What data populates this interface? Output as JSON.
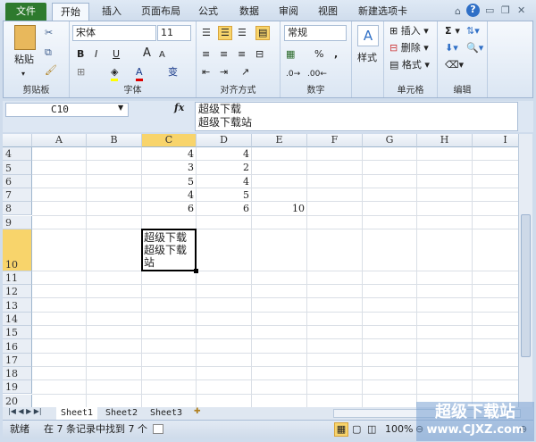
{
  "tabs": [
    "文件",
    "开始",
    "插入",
    "页面布局",
    "公式",
    "数据",
    "审阅",
    "视图",
    "新建选项卡"
  ],
  "ribbon": {
    "clipboard": {
      "label": "剪贴板",
      "paste": "粘贴"
    },
    "font": {
      "label": "字体",
      "font_name": "宋体",
      "font_size": "11"
    },
    "alignment": {
      "label": "对齐方式"
    },
    "number": {
      "label": "数字",
      "format": "常规",
      "percent": "%",
      "comma": ","
    },
    "styles": {
      "label": "样式"
    },
    "cells": {
      "label": "单元格",
      "insert": "插入",
      "delete": "删除",
      "format": "格式"
    },
    "editing": {
      "label": "编辑"
    }
  },
  "formula_bar": {
    "name_box": "C10",
    "fx": "fx",
    "content_line1": "超级下载",
    "content_line2": "超级下载站"
  },
  "columns": [
    "A",
    "B",
    "C",
    "D",
    "E",
    "F",
    "G",
    "H",
    "I"
  ],
  "rows": [
    "4",
    "5",
    "6",
    "7",
    "8",
    "9",
    "10",
    "11",
    "12",
    "13",
    "14",
    "15",
    "16",
    "17",
    "18",
    "19",
    "20"
  ],
  "cells": [
    {
      "ref": "C4",
      "value": "4"
    },
    {
      "ref": "D4",
      "value": "4"
    },
    {
      "ref": "C5",
      "value": "3"
    },
    {
      "ref": "D5",
      "value": "2"
    },
    {
      "ref": "C6",
      "value": "5"
    },
    {
      "ref": "D6",
      "value": "4"
    },
    {
      "ref": "C7",
      "value": "4"
    },
    {
      "ref": "D7",
      "value": "5"
    },
    {
      "ref": "C8",
      "value": "6"
    },
    {
      "ref": "D8",
      "value": "6"
    },
    {
      "ref": "E8",
      "value": "10"
    }
  ],
  "active_cell": {
    "ref": "C10",
    "lines": [
      "超级下载",
      "超级下载站"
    ]
  },
  "sheets": [
    "Sheet1",
    "Sheet2",
    "Sheet3"
  ],
  "active_sheet": "Sheet1",
  "status": {
    "ready": "就绪",
    "message": "在 7 条记录中找到 7 个",
    "zoom": "100%"
  },
  "watermark": {
    "line1": "超级下载站",
    "line2": "www.CJXZ.com"
  }
}
